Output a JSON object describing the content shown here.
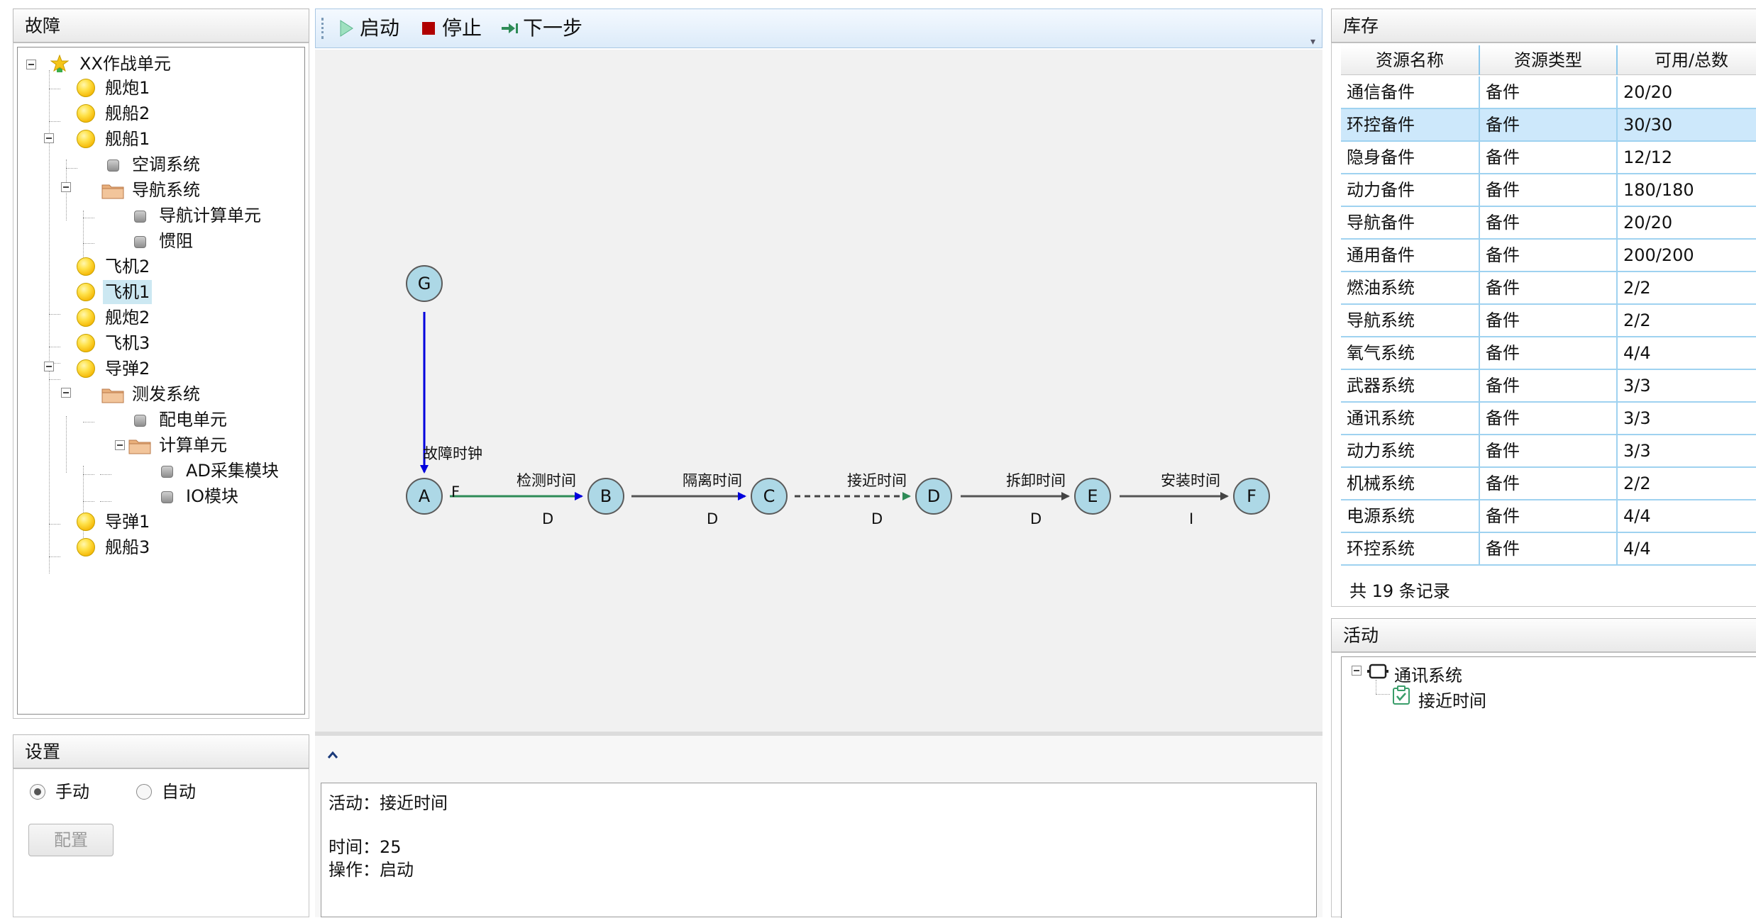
{
  "fault_panel": {
    "title": "故障",
    "tree": [
      {
        "label": "XX作战单元",
        "icon": "medal-star-icon"
      },
      {
        "label": "舰炮1",
        "icon": "yellow-ball-icon"
      },
      {
        "label": "舰船2",
        "icon": "yellow-ball-icon"
      },
      {
        "label": "舰船1",
        "icon": "yellow-ball-icon"
      },
      {
        "label": "空调系统",
        "icon": "gray-square-icon"
      },
      {
        "label": "导航系统",
        "icon": "folder-icon"
      },
      {
        "label": "导航计算单元",
        "icon": "gray-square-icon"
      },
      {
        "label": "惯阻",
        "icon": "gray-square-icon"
      },
      {
        "label": "飞机2",
        "icon": "yellow-ball-icon"
      },
      {
        "label": "飞机1",
        "icon": "yellow-ball-icon"
      },
      {
        "label": "舰炮2",
        "icon": "yellow-ball-icon"
      },
      {
        "label": "飞机3",
        "icon": "yellow-ball-icon"
      },
      {
        "label": "导弹2",
        "icon": "yellow-ball-icon"
      },
      {
        "label": "测发系统",
        "icon": "folder-icon"
      },
      {
        "label": "配电单元",
        "icon": "gray-square-icon"
      },
      {
        "label": "计算单元",
        "icon": "folder-icon"
      },
      {
        "label": "AD采集模块",
        "icon": "gray-square-icon"
      },
      {
        "label": "IO模块",
        "icon": "gray-square-icon"
      },
      {
        "label": "导弹1",
        "icon": "yellow-ball-icon"
      },
      {
        "label": "舰船3",
        "icon": "yellow-ball-icon"
      }
    ],
    "selected": "飞机1"
  },
  "settings_panel": {
    "title": "设置",
    "mode_manual": "手动",
    "mode_auto": "自动",
    "selected_mode": "手动",
    "config_button": "配置"
  },
  "toolbar": {
    "start": "启动",
    "stop": "停止",
    "next": "下一步"
  },
  "diagram": {
    "nodes": [
      "G",
      "A",
      "B",
      "C",
      "D",
      "E",
      "F"
    ],
    "edge_g_a": "故障时钟",
    "marker_a": "F",
    "edges": [
      {
        "label": "检测时间",
        "tag": "D"
      },
      {
        "label": "隔离时间",
        "tag": "D"
      },
      {
        "label": "接近时间",
        "tag": "D"
      },
      {
        "label": "拆卸时间",
        "tag": "D"
      },
      {
        "label": "安装时间",
        "tag": "I"
      }
    ]
  },
  "log": {
    "collapse_icon": "chevron-up-icon",
    "activity": "活动：接近时间",
    "time": "时间：25",
    "operation": "操作：启动"
  },
  "inventory_panel": {
    "title": "库存",
    "columns": [
      "资源名称",
      "资源类型",
      "可用/总数"
    ],
    "rows": [
      [
        "通信备件",
        "备件",
        "20/20"
      ],
      [
        "环控备件",
        "备件",
        "30/30"
      ],
      [
        "隐身备件",
        "备件",
        "12/12"
      ],
      [
        "动力备件",
        "备件",
        "180/180"
      ],
      [
        "导航备件",
        "备件",
        "20/20"
      ],
      [
        "通用备件",
        "备件",
        "200/200"
      ],
      [
        "燃油系统",
        "备件",
        "2/2"
      ],
      [
        "导航系统",
        "备件",
        "2/2"
      ],
      [
        "氧气系统",
        "备件",
        "4/4"
      ],
      [
        "武器系统",
        "备件",
        "3/3"
      ],
      [
        "通讯系统",
        "备件",
        "3/3"
      ],
      [
        "动力系统",
        "备件",
        "3/3"
      ],
      [
        "机械系统",
        "备件",
        "2/2"
      ],
      [
        "电源系统",
        "备件",
        "4/4"
      ],
      [
        "环控系统",
        "备件",
        "4/4"
      ]
    ],
    "selected_row": "环控备件",
    "record_count": "共 19 条记录"
  },
  "activity_panel": {
    "title": "活动",
    "root": "通讯系统",
    "child": "接近时间"
  },
  "colors": {
    "node_fill": "#add8e6",
    "edge_blue": "#0000dd",
    "edge_green": "#2e8b57",
    "toolbar_start": "#7fd0a8",
    "toolbar_stop": "#b00000",
    "toolbar_next": "#2e8b57"
  }
}
